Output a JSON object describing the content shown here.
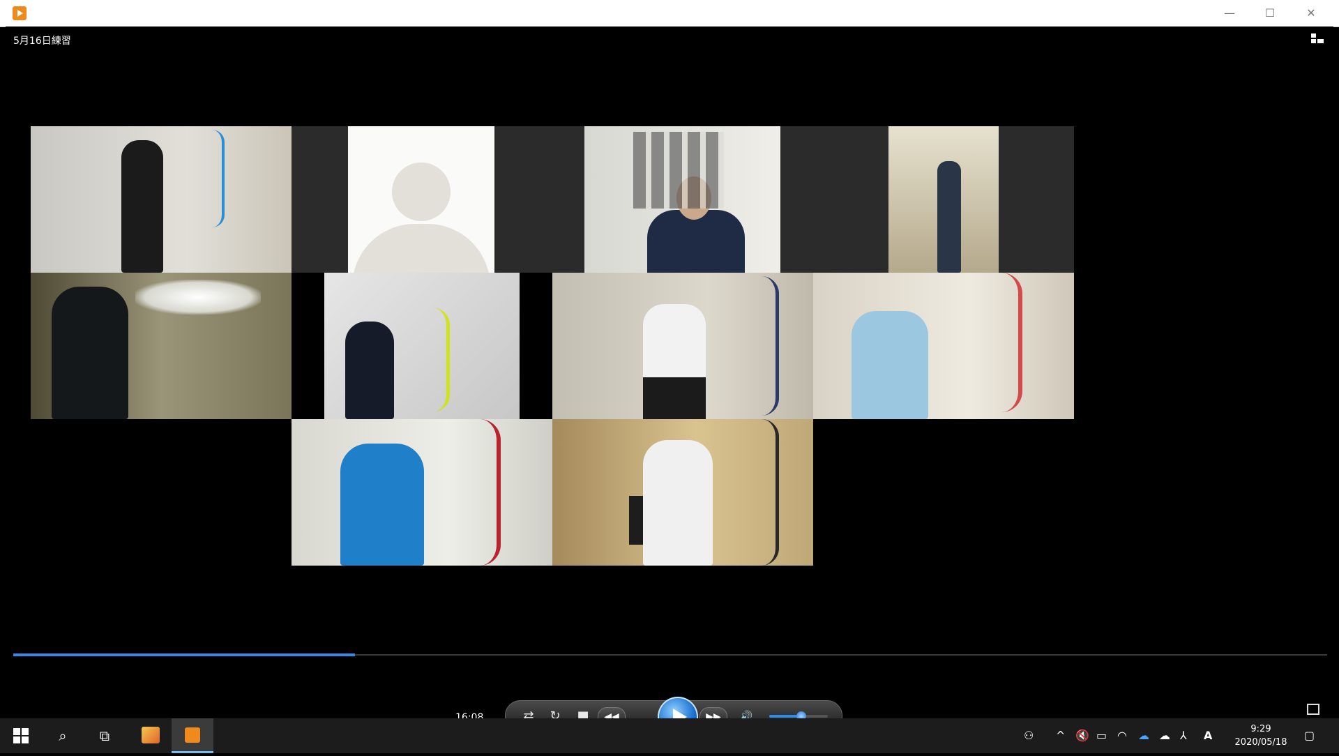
{
  "window": {
    "app_icon": "media-player-icon",
    "minimize": "—",
    "maximize": "☐",
    "close": "✕"
  },
  "player": {
    "title": "5月16日練習",
    "current_time": "16:08",
    "progress_fraction": 0.26,
    "volume_fraction": 0.55
  },
  "controls": {
    "shuffle_icon": "⇄",
    "repeat_icon": "↻",
    "stop_icon": "■",
    "rewind_icon": "◀◀",
    "forward_icon": "▶▶",
    "volume_icon": "🔊"
  },
  "taskbar": {
    "start_icon": "windows-icon",
    "search_icon": "⌕",
    "task_view_icon": "⧉",
    "tray_arrow": "^",
    "time": "9:29",
    "date": "2020/05/18"
  }
}
